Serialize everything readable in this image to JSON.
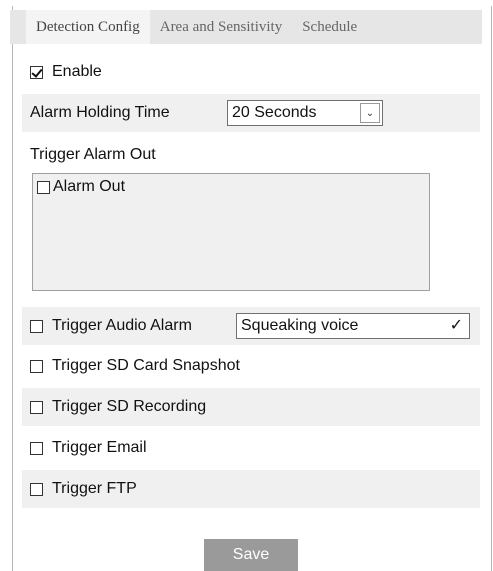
{
  "tabs": [
    {
      "label": "Detection Config",
      "active": true
    },
    {
      "label": "Area and Sensitivity",
      "active": false
    },
    {
      "label": "Schedule",
      "active": false
    }
  ],
  "enable": {
    "label": "Enable",
    "checked": true
  },
  "alarm_holding": {
    "label": "Alarm Holding Time",
    "value": "20 Seconds"
  },
  "trigger_alarm_out": {
    "label": "Trigger Alarm Out",
    "option_label": "Alarm Out",
    "checked": false
  },
  "audio_alarm": {
    "label": "Trigger Audio Alarm",
    "value": "Squeaking voice",
    "checked": false
  },
  "sd_snapshot": {
    "label": "Trigger SD Card Snapshot",
    "checked": false
  },
  "sd_recording": {
    "label": "Trigger SD Recording",
    "checked": false
  },
  "email": {
    "label": "Trigger Email",
    "checked": false
  },
  "ftp": {
    "label": "Trigger FTP",
    "checked": false
  },
  "save_label": "Save",
  "colors": {
    "save_button": "#9a9a9a",
    "tab_bar": "#e6e6e6",
    "row_gray": "#f0f0f0"
  }
}
